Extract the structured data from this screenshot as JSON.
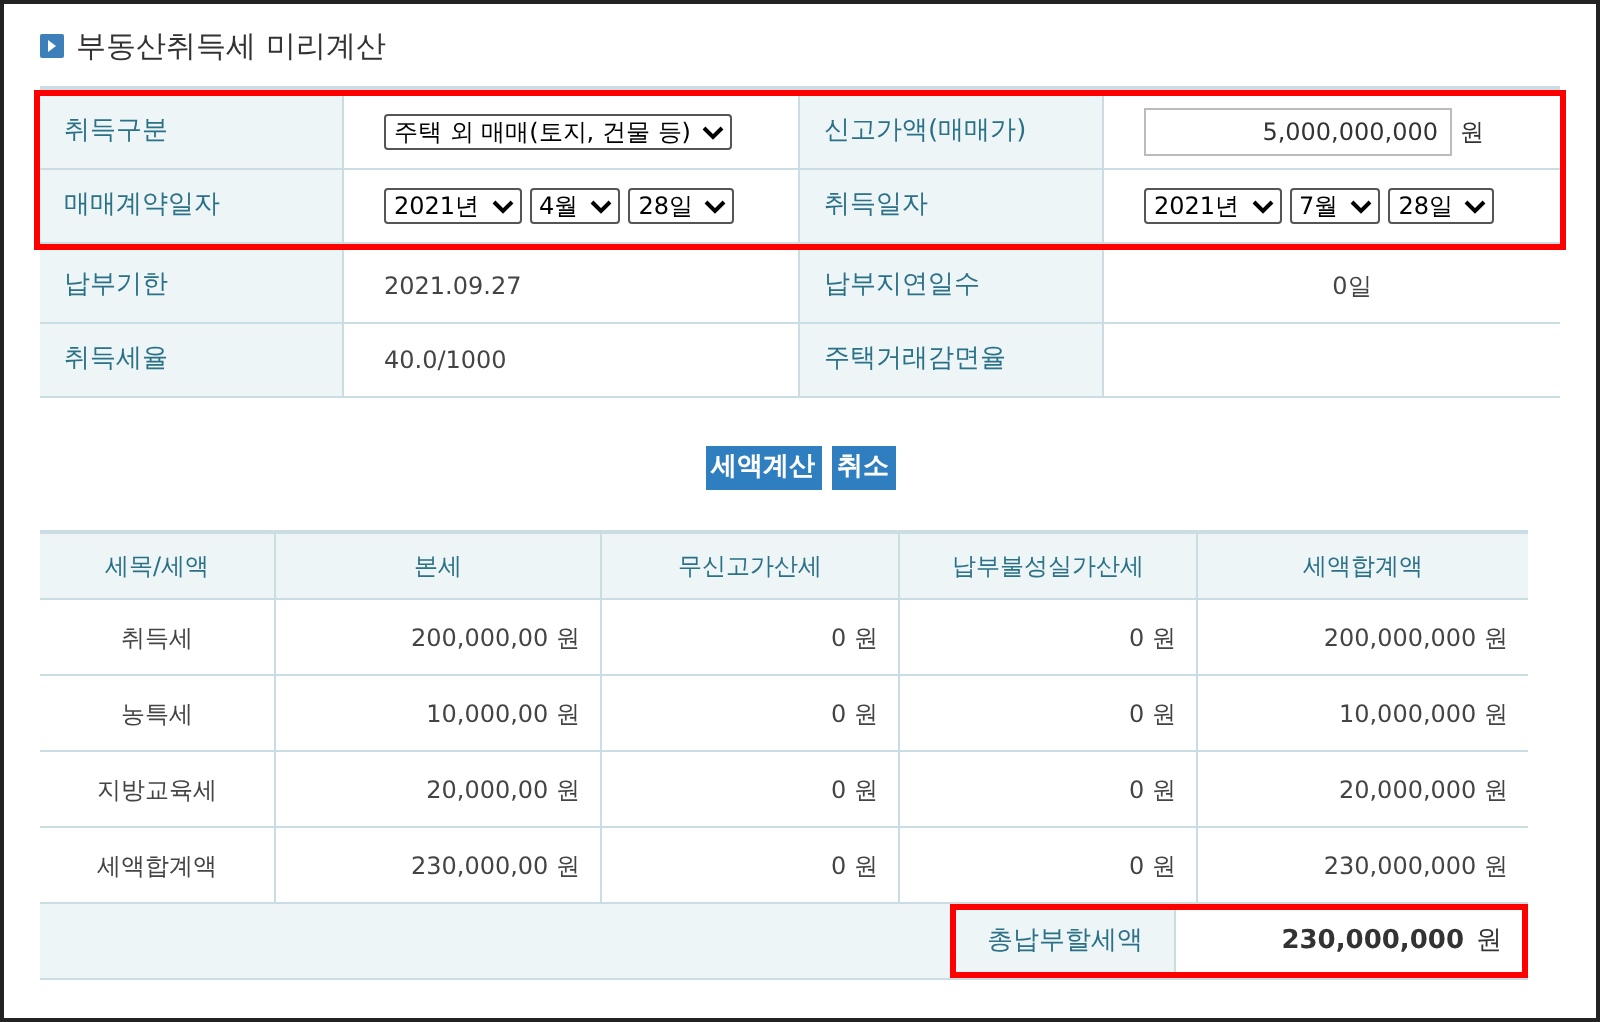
{
  "title": "부동산취득세 미리계산",
  "form": {
    "rows": [
      {
        "highlighted": true,
        "cells": [
          {
            "label": "취득구분",
            "kind": "select",
            "parts": [
              "주택 외 매매(토지, 건물 등)"
            ]
          },
          {
            "label": "신고가액(매매가)",
            "kind": "input",
            "value": "5,000,000,000",
            "unit": "원"
          }
        ]
      },
      {
        "highlighted": true,
        "cells": [
          {
            "label": "매매계약일자",
            "kind": "select",
            "parts": [
              "2021년",
              "4월",
              "28일"
            ]
          },
          {
            "label": "취득일자",
            "kind": "select",
            "parts": [
              "2021년",
              "7월",
              "28일"
            ]
          }
        ]
      },
      {
        "highlighted": false,
        "cells": [
          {
            "label": "납부기한",
            "kind": "text",
            "value": "2021.09.27"
          },
          {
            "label": "납부지연일수",
            "kind": "count",
            "value": "0일"
          }
        ]
      },
      {
        "highlighted": false,
        "cells": [
          {
            "label": "취득세율",
            "kind": "text",
            "value": "40.0/1000"
          },
          {
            "label": "주택거래감면율",
            "kind": "text"
          }
        ]
      }
    ]
  },
  "buttons": [
    "세액계산",
    "취소"
  ],
  "table": {
    "columns": [
      "세목/세액",
      "본세",
      "무신고가산세",
      "납부불성실가산세",
      "세액합계액"
    ],
    "rows": [
      [
        "취득세",
        "200,000,00 원",
        "0 원",
        "0 원",
        "200,000,000 원"
      ],
      [
        "농특세",
        "10,000,00 원",
        "0 원",
        "0 원",
        "10,000,000 원"
      ],
      [
        "지방교육세",
        "20,000,00 원",
        "0 원",
        "0 원",
        "20,000,000 원"
      ],
      [
        "세액합계액",
        "230,000,00 원",
        "0 원",
        "0 원",
        "230,000,000 원"
      ]
    ],
    "total": {
      "label": "총납부할세액",
      "value": "230,000,000",
      "unit": "원",
      "highlighted": true
    }
  }
}
